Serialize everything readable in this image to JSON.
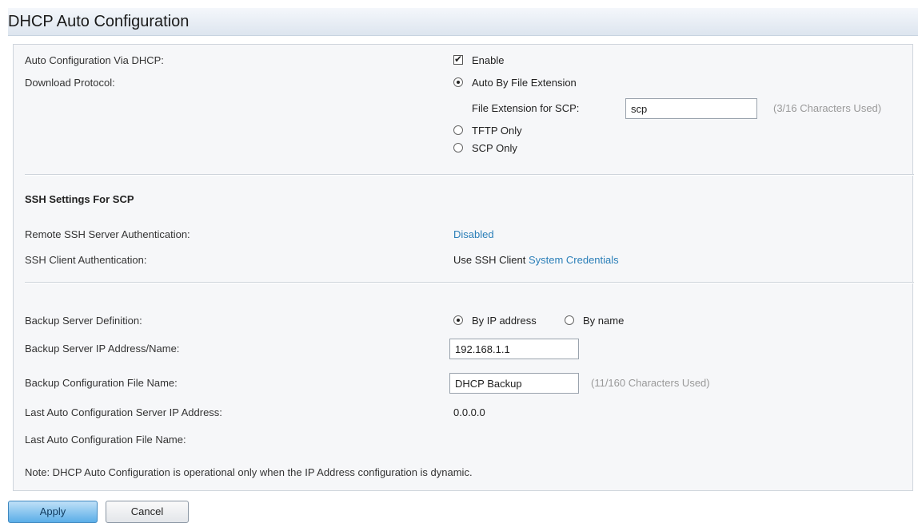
{
  "page": {
    "title": "DHCP Auto Configuration"
  },
  "auto_config": {
    "label": "Auto Configuration Via DHCP:",
    "enable_checked": true,
    "enable_label": "Enable"
  },
  "download_protocol": {
    "label": "Download Protocol:",
    "selected": "Auto By File Extension",
    "options": [
      "Auto By File Extension",
      "TFTP Only",
      "SCP Only"
    ],
    "scp_ext_label": "File Extension for SCP:",
    "scp_ext_value": "scp",
    "scp_ext_hint": "(3/16 Characters Used)"
  },
  "ssh": {
    "heading": "SSH Settings For SCP",
    "remote_auth_label": "Remote SSH Server Authentication:",
    "remote_auth_value": "Disabled",
    "client_auth_label": "SSH Client Authentication:",
    "client_auth_prefix": "Use SSH Client",
    "client_auth_link": "System Credentials"
  },
  "backup": {
    "definition_label": "Backup Server Definition:",
    "definition_options": [
      "By IP address",
      "By name"
    ],
    "definition_selected": "By IP address",
    "server_label": "Backup Server IP Address/Name:",
    "server_value": "192.168.1.1",
    "file_label": "Backup Configuration File Name:",
    "file_value": "DHCP Backup",
    "file_hint": "(11/160 Characters Used)",
    "last_ip_label": "Last Auto Configuration Server IP Address:",
    "last_ip_value": "0.0.0.0",
    "last_file_label": "Last Auto Configuration File Name:",
    "last_file_value": ""
  },
  "note": "Note: DHCP Auto Configuration is operational only when the IP Address configuration is dynamic.",
  "buttons": {
    "apply": "Apply",
    "cancel": "Cancel"
  },
  "colors": {
    "link": "#2b7fb8",
    "hint": "#999999",
    "apply_button": "#5aaee8"
  }
}
